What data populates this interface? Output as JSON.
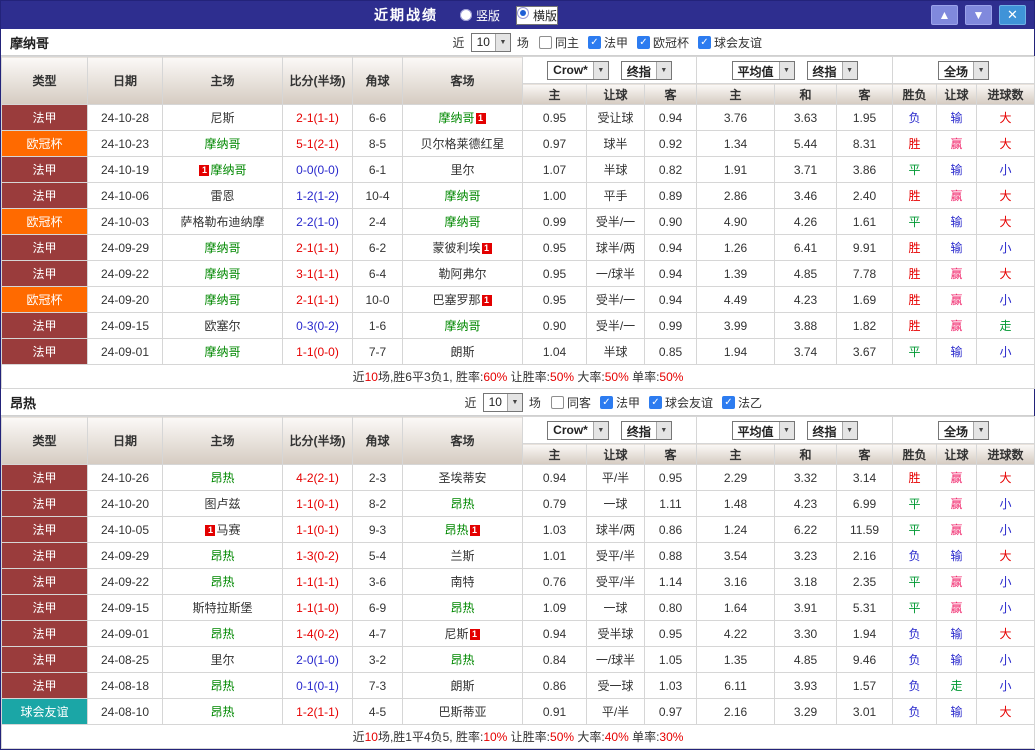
{
  "titlebar": {
    "title": "近期战绩",
    "radios": [
      {
        "label": "竖版",
        "selected": false
      },
      {
        "label": "横版",
        "selected": true
      }
    ],
    "up_button": "▲",
    "down_button": "▼",
    "close_button": "✕"
  },
  "headers": {
    "left": [
      "类型",
      "日期",
      "主场",
      "比分(半场)",
      "角球",
      "客场"
    ],
    "asia": [
      "主",
      "让球",
      "客"
    ],
    "europe": [
      "主",
      "和",
      "客"
    ],
    "result": [
      "胜负",
      "让球",
      "进球数"
    ]
  },
  "colors": {
    "league": {
      "法甲": "#9a3c3c",
      "欧冠杯": "#ff6a00",
      "球会友谊": "#1ba6a6"
    },
    "score": {
      "red": "#e60000",
      "blue": "#2828cc"
    },
    "outcome": {
      "胜": "#e60000",
      "平": "#009933",
      "负": "#2828cc",
      "赢": "#f0256b",
      "输": "#2828cc",
      "走": "#009933",
      "大": "#e60000",
      "小": "#2828cc"
    },
    "focal_team": "#008800",
    "plain_team": "#333333",
    "card": "#e30000"
  },
  "sections": [
    {
      "team": "摩纳哥",
      "filter": {
        "prefix": "近",
        "count": "10",
        "suffix": "场",
        "checks": [
          {
            "label": "同主",
            "checked": false
          },
          {
            "label": "法甲",
            "checked": true
          },
          {
            "label": "欧冠杯",
            "checked": true
          },
          {
            "label": "球会友谊",
            "checked": true
          }
        ]
      },
      "selects": {
        "bookmaker": "Crow*",
        "asia": "终指",
        "europe_avg": "平均值",
        "europe": "终指",
        "scope": "全场"
      },
      "rows": [
        {
          "type": "法甲",
          "date": "24-10-28",
          "home": {
            "name": "尼斯"
          },
          "score": "2-1(1-1)",
          "sc": "red",
          "corner": "6-6",
          "away": {
            "name": "摩纳哥",
            "focal": true,
            "card": "after"
          },
          "asia": [
            "0.95",
            "受让球",
            "0.94"
          ],
          "europe": [
            "3.76",
            "3.63",
            "1.95"
          ],
          "res": [
            "负",
            "输",
            "大"
          ]
        },
        {
          "type": "欧冠杯",
          "date": "24-10-23",
          "home": {
            "name": "摩纳哥",
            "focal": true
          },
          "score": "5-1(2-1)",
          "sc": "red",
          "corner": "8-5",
          "away": {
            "name": "贝尔格莱德红星"
          },
          "asia": [
            "0.97",
            "球半",
            "0.92"
          ],
          "europe": [
            "1.34",
            "5.44",
            "8.31"
          ],
          "res": [
            "胜",
            "赢",
            "大"
          ]
        },
        {
          "type": "法甲",
          "date": "24-10-19",
          "home": {
            "name": "摩纳哥",
            "focal": true,
            "card": "before"
          },
          "score": "0-0(0-0)",
          "sc": "blue",
          "corner": "6-1",
          "away": {
            "name": "里尔"
          },
          "asia": [
            "1.07",
            "半球",
            "0.82"
          ],
          "europe": [
            "1.91",
            "3.71",
            "3.86"
          ],
          "res": [
            "平",
            "输",
            "小"
          ]
        },
        {
          "type": "法甲",
          "date": "24-10-06",
          "home": {
            "name": "雷恩"
          },
          "score": "1-2(1-2)",
          "sc": "blue",
          "corner": "10-4",
          "away": {
            "name": "摩纳哥",
            "focal": true
          },
          "asia": [
            "1.00",
            "平手",
            "0.89"
          ],
          "europe": [
            "2.86",
            "3.46",
            "2.40"
          ],
          "res": [
            "胜",
            "赢",
            "大"
          ]
        },
        {
          "type": "欧冠杯",
          "date": "24-10-03",
          "home": {
            "name": "萨格勒布迪纳摩"
          },
          "score": "2-2(1-0)",
          "sc": "blue",
          "corner": "2-4",
          "away": {
            "name": "摩纳哥",
            "focal": true
          },
          "asia": [
            "0.99",
            "受半/一",
            "0.90"
          ],
          "europe": [
            "4.90",
            "4.26",
            "1.61"
          ],
          "res": [
            "平",
            "输",
            "大"
          ]
        },
        {
          "type": "法甲",
          "date": "24-09-29",
          "home": {
            "name": "摩纳哥",
            "focal": true
          },
          "score": "2-1(1-1)",
          "sc": "red",
          "corner": "6-2",
          "away": {
            "name": "蒙彼利埃",
            "card": "after"
          },
          "asia": [
            "0.95",
            "球半/两",
            "0.94"
          ],
          "europe": [
            "1.26",
            "6.41",
            "9.91"
          ],
          "res": [
            "胜",
            "输",
            "小"
          ]
        },
        {
          "type": "法甲",
          "date": "24-09-22",
          "home": {
            "name": "摩纳哥",
            "focal": true
          },
          "score": "3-1(1-1)",
          "sc": "red",
          "corner": "6-4",
          "away": {
            "name": "勒阿弗尔"
          },
          "asia": [
            "0.95",
            "一/球半",
            "0.94"
          ],
          "europe": [
            "1.39",
            "4.85",
            "7.78"
          ],
          "res": [
            "胜",
            "赢",
            "大"
          ]
        },
        {
          "type": "欧冠杯",
          "date": "24-09-20",
          "home": {
            "name": "摩纳哥",
            "focal": true
          },
          "score": "2-1(1-1)",
          "sc": "red",
          "corner": "10-0",
          "away": {
            "name": "巴塞罗那",
            "card": "after"
          },
          "asia": [
            "0.95",
            "受半/一",
            "0.94"
          ],
          "europe": [
            "4.49",
            "4.23",
            "1.69"
          ],
          "res": [
            "胜",
            "赢",
            "小"
          ]
        },
        {
          "type": "法甲",
          "date": "24-09-15",
          "home": {
            "name": "欧塞尔"
          },
          "score": "0-3(0-2)",
          "sc": "blue",
          "corner": "1-6",
          "away": {
            "name": "摩纳哥",
            "focal": true
          },
          "asia": [
            "0.90",
            "受半/一",
            "0.99"
          ],
          "europe": [
            "3.99",
            "3.88",
            "1.82"
          ],
          "res": [
            "胜",
            "赢",
            "走"
          ]
        },
        {
          "type": "法甲",
          "date": "24-09-01",
          "home": {
            "name": "摩纳哥",
            "focal": true
          },
          "score": "1-1(0-0)",
          "sc": "red",
          "corner": "7-7",
          "away": {
            "name": "朗斯"
          },
          "asia": [
            "1.04",
            "半球",
            "0.85"
          ],
          "europe": [
            "1.94",
            "3.74",
            "3.67"
          ],
          "res": [
            "平",
            "输",
            "小"
          ]
        }
      ],
      "summary": [
        {
          "t": "近",
          "c": "#333333"
        },
        {
          "t": "10",
          "c": "#e60000"
        },
        {
          "t": "场,胜6平3负1, 胜率:",
          "c": "#333333"
        },
        {
          "t": "60%",
          "c": "#e60000"
        },
        {
          "t": " 让胜率:",
          "c": "#333333"
        },
        {
          "t": "50%",
          "c": "#e60000"
        },
        {
          "t": " 大率:",
          "c": "#333333"
        },
        {
          "t": "50%",
          "c": "#e60000"
        },
        {
          "t": " 单率:",
          "c": "#333333"
        },
        {
          "t": "50%",
          "c": "#e60000"
        }
      ]
    },
    {
      "team": "昂热",
      "filter": {
        "prefix": "近",
        "count": "10",
        "suffix": "场",
        "checks": [
          {
            "label": "同客",
            "checked": false
          },
          {
            "label": "法甲",
            "checked": true
          },
          {
            "label": "球会友谊",
            "checked": true
          },
          {
            "label": "法乙",
            "checked": true
          }
        ]
      },
      "selects": {
        "bookmaker": "Crow*",
        "asia": "终指",
        "europe_avg": "平均值",
        "europe": "终指",
        "scope": "全场"
      },
      "rows": [
        {
          "type": "法甲",
          "date": "24-10-26",
          "home": {
            "name": "昂热",
            "focal": true
          },
          "score": "4-2(2-1)",
          "sc": "red",
          "corner": "2-3",
          "away": {
            "name": "圣埃蒂安"
          },
          "asia": [
            "0.94",
            "平/半",
            "0.95"
          ],
          "europe": [
            "2.29",
            "3.32",
            "3.14"
          ],
          "res": [
            "胜",
            "赢",
            "大"
          ]
        },
        {
          "type": "法甲",
          "date": "24-10-20",
          "home": {
            "name": "图卢兹"
          },
          "score": "1-1(0-1)",
          "sc": "red",
          "corner": "8-2",
          "away": {
            "name": "昂热",
            "focal": true
          },
          "asia": [
            "0.79",
            "一球",
            "1.11"
          ],
          "europe": [
            "1.48",
            "4.23",
            "6.99"
          ],
          "res": [
            "平",
            "赢",
            "小"
          ]
        },
        {
          "type": "法甲",
          "date": "24-10-05",
          "home": {
            "name": "马赛",
            "card": "before"
          },
          "score": "1-1(0-1)",
          "sc": "red",
          "corner": "9-3",
          "away": {
            "name": "昂热",
            "focal": true,
            "card": "after"
          },
          "asia": [
            "1.03",
            "球半/两",
            "0.86"
          ],
          "europe": [
            "1.24",
            "6.22",
            "11.59"
          ],
          "res": [
            "平",
            "赢",
            "小"
          ]
        },
        {
          "type": "法甲",
          "date": "24-09-29",
          "home": {
            "name": "昂热",
            "focal": true
          },
          "score": "1-3(0-2)",
          "sc": "red",
          "corner": "5-4",
          "away": {
            "name": "兰斯"
          },
          "asia": [
            "1.01",
            "受平/半",
            "0.88"
          ],
          "europe": [
            "3.54",
            "3.23",
            "2.16"
          ],
          "res": [
            "负",
            "输",
            "大"
          ]
        },
        {
          "type": "法甲",
          "date": "24-09-22",
          "home": {
            "name": "昂热",
            "focal": true
          },
          "score": "1-1(1-1)",
          "sc": "red",
          "corner": "3-6",
          "away": {
            "name": "南特"
          },
          "asia": [
            "0.76",
            "受平/半",
            "1.14"
          ],
          "europe": [
            "3.16",
            "3.18",
            "2.35"
          ],
          "res": [
            "平",
            "赢",
            "小"
          ]
        },
        {
          "type": "法甲",
          "date": "24-09-15",
          "home": {
            "name": "斯特拉斯堡"
          },
          "score": "1-1(1-0)",
          "sc": "red",
          "corner": "6-9",
          "away": {
            "name": "昂热",
            "focal": true
          },
          "asia": [
            "1.09",
            "一球",
            "0.80"
          ],
          "europe": [
            "1.64",
            "3.91",
            "5.31"
          ],
          "res": [
            "平",
            "赢",
            "小"
          ]
        },
        {
          "type": "法甲",
          "date": "24-09-01",
          "home": {
            "name": "昂热",
            "focal": true
          },
          "score": "1-4(0-2)",
          "sc": "red",
          "corner": "4-7",
          "away": {
            "name": "尼斯",
            "card": "after"
          },
          "asia": [
            "0.94",
            "受半球",
            "0.95"
          ],
          "europe": [
            "4.22",
            "3.30",
            "1.94"
          ],
          "res": [
            "负",
            "输",
            "大"
          ]
        },
        {
          "type": "法甲",
          "date": "24-08-25",
          "home": {
            "name": "里尔"
          },
          "score": "2-0(1-0)",
          "sc": "blue",
          "corner": "3-2",
          "away": {
            "name": "昂热",
            "focal": true
          },
          "asia": [
            "0.84",
            "一/球半",
            "1.05"
          ],
          "europe": [
            "1.35",
            "4.85",
            "9.46"
          ],
          "res": [
            "负",
            "输",
            "小"
          ]
        },
        {
          "type": "法甲",
          "date": "24-08-18",
          "home": {
            "name": "昂热",
            "focal": true
          },
          "score": "0-1(0-1)",
          "sc": "blue",
          "corner": "7-3",
          "away": {
            "name": "朗斯"
          },
          "asia": [
            "0.86",
            "受一球",
            "1.03"
          ],
          "europe": [
            "6.11",
            "3.93",
            "1.57"
          ],
          "res": [
            "负",
            "走",
            "小"
          ]
        },
        {
          "type": "球会友谊",
          "date": "24-08-10",
          "home": {
            "name": "昂热",
            "focal": true
          },
          "score": "1-2(1-1)",
          "sc": "red",
          "corner": "4-5",
          "away": {
            "name": "巴斯蒂亚"
          },
          "asia": [
            "0.91",
            "平/半",
            "0.97"
          ],
          "europe": [
            "2.16",
            "3.29",
            "3.01"
          ],
          "res": [
            "负",
            "输",
            "大"
          ]
        }
      ],
      "summary": [
        {
          "t": "近",
          "c": "#333333"
        },
        {
          "t": "10",
          "c": "#e60000"
        },
        {
          "t": "场,胜1平4负5, 胜率:",
          "c": "#333333"
        },
        {
          "t": "10%",
          "c": "#e60000"
        },
        {
          "t": " 让胜率:",
          "c": "#333333"
        },
        {
          "t": "50%",
          "c": "#e60000"
        },
        {
          "t": " 大率:",
          "c": "#333333"
        },
        {
          "t": "40%",
          "c": "#e60000"
        },
        {
          "t": " 单率:",
          "c": "#333333"
        },
        {
          "t": "30%",
          "c": "#e60000"
        }
      ]
    }
  ]
}
